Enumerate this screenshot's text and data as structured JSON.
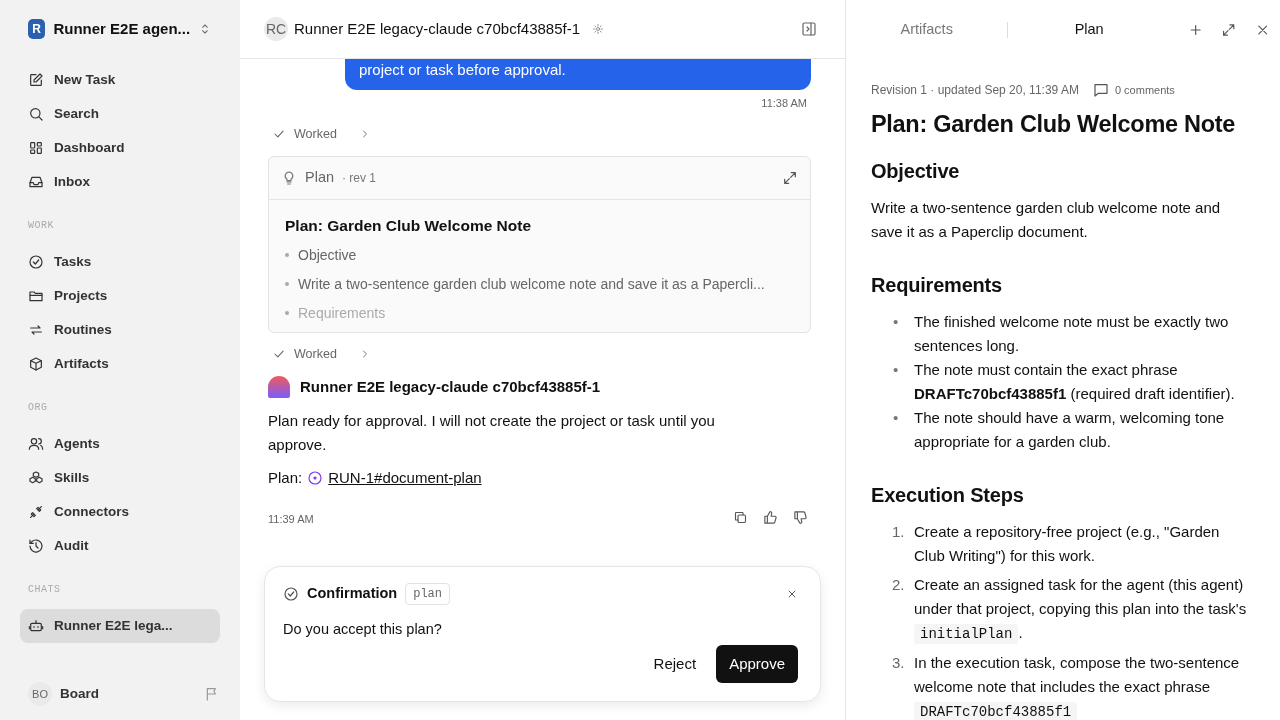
{
  "sidebar": {
    "workspace": {
      "initial": "R",
      "name": "Runner E2E agen..."
    },
    "sections": [
      {
        "items": [
          {
            "label": "New Task",
            "selected": false
          },
          {
            "label": "Search",
            "selected": false
          },
          {
            "label": "Dashboard",
            "selected": false
          },
          {
            "label": "Inbox",
            "selected": false
          }
        ]
      },
      {
        "label": "WORK",
        "items": [
          {
            "label": "Tasks",
            "selected": false
          },
          {
            "label": "Projects",
            "selected": false
          },
          {
            "label": "Routines",
            "selected": false
          },
          {
            "label": "Artifacts",
            "selected": false
          }
        ]
      },
      {
        "label": "ORG",
        "items": [
          {
            "label": "Agents",
            "selected": false
          },
          {
            "label": "Skills",
            "selected": false
          },
          {
            "label": "Connectors",
            "selected": false
          },
          {
            "label": "Audit",
            "selected": false
          }
        ]
      },
      {
        "label": "CHATS",
        "items": [
          {
            "label": "Runner E2E lega...",
            "selected": true
          }
        ]
      }
    ],
    "user": {
      "initials": "BO",
      "name": "Board"
    }
  },
  "chat": {
    "header": {
      "initials": "RC",
      "title": "Runner E2E legacy-claude c70bcf43885f-1"
    },
    "user_message": {
      "text": "project or task before approval.",
      "time": "11:38 AM"
    },
    "worked_1": "Worked",
    "plan_card": {
      "title": "Plan",
      "revision": "· rev 1",
      "heading": "Plan: Garden Club Welcome Note",
      "items": [
        "Objective",
        "Write a two-sentence garden club welcome note and save it as a Papercli...",
        "Requirements"
      ]
    },
    "worked_2": "Worked",
    "agent_message": {
      "author": "Runner E2E legacy-claude c70bcf43885f-1",
      "text": "Plan ready for approval. I will not create the project or task until you approve.",
      "link_label": "Plan:",
      "link": "RUN-1#document-plan",
      "time": "11:39 AM"
    },
    "confirmation": {
      "title": "Confirmation",
      "tag": "plan",
      "question": "Do you accept this plan?",
      "buttons": [
        {
          "label": "Reject",
          "kind": "secondary"
        },
        {
          "label": "Approve",
          "kind": "primary"
        }
      ]
    }
  },
  "panel": {
    "tabs": [
      {
        "label": "Artifacts",
        "selected": false
      },
      {
        "label": "Plan",
        "selected": true
      }
    ],
    "meta": "Revision 1 · updated Sep 20, 11:39 AM",
    "comments": "0 comments",
    "title": "Plan: Garden Club Welcome Note",
    "blocks": [
      {
        "kind": "heading",
        "text": "Objective"
      },
      {
        "kind": "paragraph",
        "parts": [
          {
            "kind": "text",
            "text": "Write a two-sentence garden club welcome note and save it as a Paperclip document."
          }
        ]
      },
      {
        "kind": "heading",
        "text": "Requirements"
      },
      {
        "kind": "bullets",
        "items": [
          {
            "marker": "•",
            "parts": [
              {
                "kind": "text",
                "text": "The finished welcome note must be exactly two sentences long."
              }
            ]
          },
          {
            "marker": "•",
            "parts": [
              {
                "kind": "text",
                "text": "The note must contain the exact phrase "
              },
              {
                "kind": "bold",
                "text": "DRAFTc70bcf43885f1"
              },
              {
                "kind": "text",
                "text": " (required draft identifier)."
              }
            ]
          },
          {
            "marker": "•",
            "parts": [
              {
                "kind": "text",
                "text": "The note should have a warm, welcoming tone appropriate for a garden club."
              }
            ]
          }
        ]
      },
      {
        "kind": "heading",
        "text": "Execution Steps"
      },
      {
        "kind": "numbered",
        "items": [
          {
            "marker": "1.",
            "parts": [
              {
                "kind": "text",
                "text": "Create a repository-free project (e.g., \"Garden Club Writing\") for this work."
              }
            ]
          },
          {
            "marker": "2.",
            "parts": [
              {
                "kind": "text",
                "text": "Create an assigned task for the agent (this agent) under that project, copying this plan into the task's "
              },
              {
                "kind": "code",
                "text": "initialPlan"
              },
              {
                "kind": "text",
                "text": "."
              }
            ]
          },
          {
            "marker": "3.",
            "parts": [
              {
                "kind": "text",
                "text": "In the execution task, compose the two-sentence welcome note that includes the exact phrase "
              },
              {
                "kind": "code",
                "text": "DRAFTc70bcf43885f1"
              }
            ]
          }
        ]
      }
    ]
  }
}
